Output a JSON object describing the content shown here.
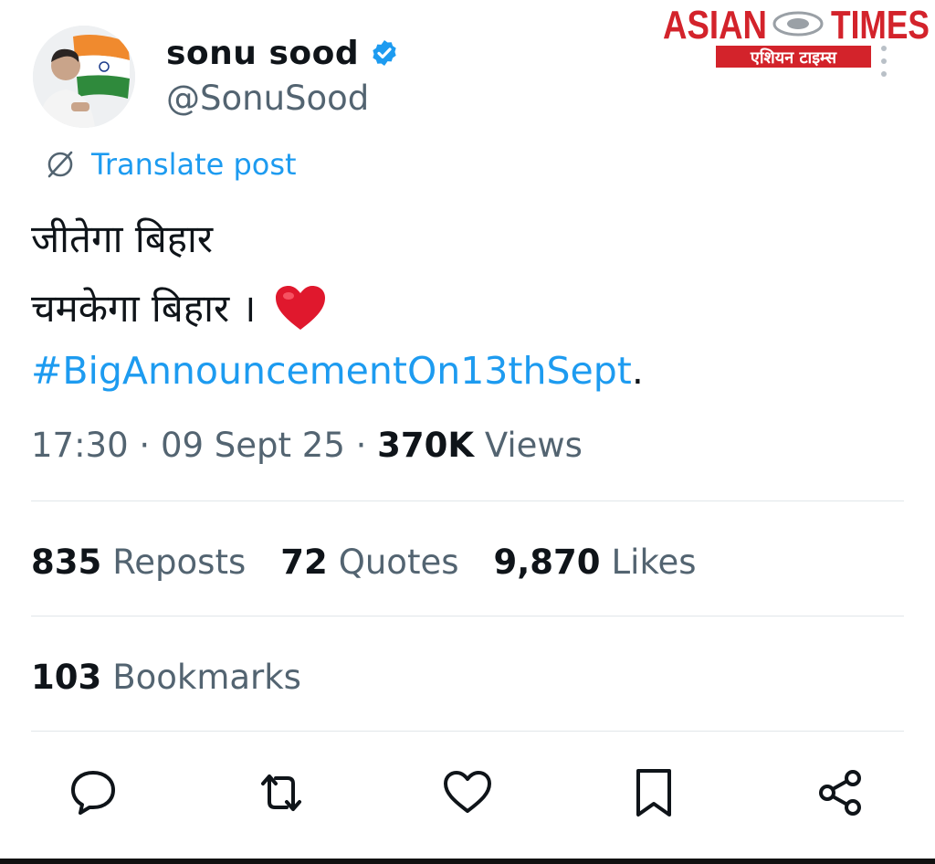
{
  "author": {
    "name": "sonu sood",
    "handle": "@SonuSood"
  },
  "watermark": {
    "text": "ASIAN TIMES",
    "subtext": "एशियन टाइम्स"
  },
  "translate_label": "Translate post",
  "post": {
    "line1": "जीतेगा बिहार",
    "line2": "चमकेगा बिहार ।",
    "hashtag": "#BigAnnouncementOn13thSept",
    "hashtag_suffix": "."
  },
  "meta": {
    "time": "17:30",
    "sep": "·",
    "date": "09 Sept 25",
    "views_count": "370K",
    "views_label": "Views"
  },
  "stats": {
    "reposts_count": "835",
    "reposts_label": "Reposts",
    "quotes_count": "72",
    "quotes_label": "Quotes",
    "likes_count": "9,870",
    "likes_label": "Likes",
    "bookmarks_count": "103",
    "bookmarks_label": "Bookmarks"
  },
  "icons": {
    "reply": "speech-bubble-icon",
    "repost": "repost-arrows-icon",
    "like": "heart-outline-icon",
    "bookmark": "bookmark-icon",
    "share": "share-nodes-icon"
  },
  "colors": {
    "accent": "#1d9bf0",
    "text": "#0f1419",
    "secondary": "#536471",
    "heart": "#e0182d",
    "logo_red": "#d3232b"
  }
}
